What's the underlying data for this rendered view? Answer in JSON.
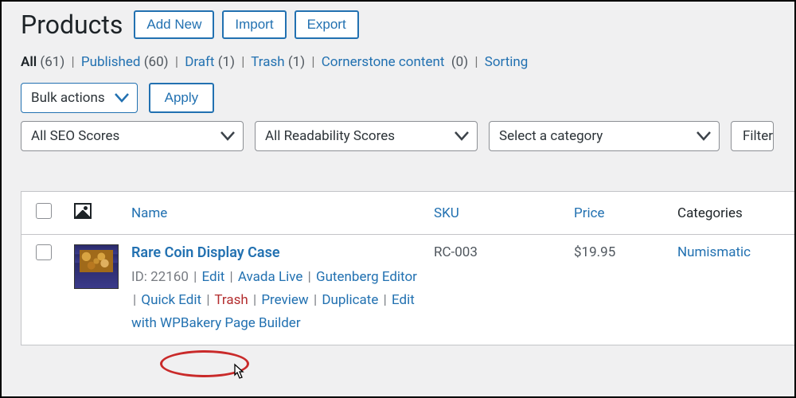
{
  "page_title": "Products",
  "header_buttons": {
    "add_new": "Add New",
    "import": "Import",
    "export": "Export"
  },
  "status_filters": {
    "all": {
      "label": "All",
      "count": "(61)"
    },
    "published": {
      "label": "Published",
      "count": "(60)"
    },
    "draft": {
      "label": "Draft",
      "count": "(1)"
    },
    "trash": {
      "label": "Trash",
      "count": "(1)"
    },
    "cornerstone": {
      "label": "Cornerstone content",
      "count": "(0)"
    },
    "sorting": {
      "label": "Sorting"
    }
  },
  "bulk_actions": {
    "label": "Bulk actions",
    "apply": "Apply"
  },
  "filters": {
    "seo": "All SEO Scores",
    "readability": "All Readability Scores",
    "category": "Select a category",
    "button": "Filter"
  },
  "columns": {
    "name": "Name",
    "sku": "SKU",
    "price": "Price",
    "categories": "Categories"
  },
  "row": {
    "name": "Rare Coin Display Case",
    "id_label": "ID: 22160",
    "sku": "RC-003",
    "price": "$19.95",
    "category": "Numismatic",
    "actions": {
      "edit": "Edit",
      "avada": "Avada Live",
      "gutenberg": "Gutenberg Editor",
      "quick": "Quick Edit",
      "trash": "Trash",
      "preview": "Preview",
      "duplicate": "Duplicate",
      "wpbakery": "Edit with WPBakery Page Builder"
    }
  }
}
